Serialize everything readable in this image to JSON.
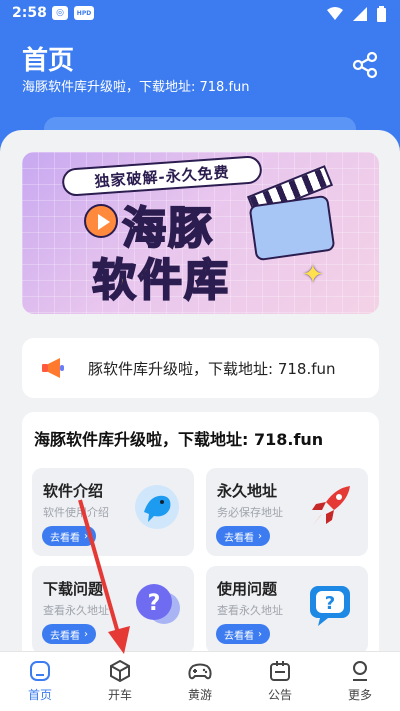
{
  "status_bar": {
    "time": "2:58",
    "badge": "HPD"
  },
  "header": {
    "title": "首页",
    "subtitle": "海豚软件库升级啦，下载地址: 718.fun"
  },
  "banner": {
    "tag": "独家破解-永久免费",
    "line1": "海豚",
    "line2": "软件库"
  },
  "notice": {
    "text": "豚软件库升级啦，下载地址: 718.fun"
  },
  "main": {
    "title": "海豚软件库升级啦，下载地址: 718.fun",
    "tiles": [
      {
        "title": "软件介绍",
        "desc": "软件使用介绍",
        "button": "去看看",
        "icon": "dolphin-icon"
      },
      {
        "title": "永久地址",
        "desc": "务必保存地址",
        "button": "去看看",
        "icon": "rocket-icon"
      },
      {
        "title": "下载问题",
        "desc": "查看永久地址",
        "button": "去看看",
        "icon": "question-bubble-icon"
      },
      {
        "title": "使用问题",
        "desc": "查看永久地址",
        "button": "去看看",
        "icon": "help-chat-icon"
      }
    ]
  },
  "bottom_nav": [
    {
      "label": "首页",
      "icon": "home-icon",
      "active": true
    },
    {
      "label": "开车",
      "icon": "cube-icon",
      "active": false
    },
    {
      "label": "黄游",
      "icon": "gamepad-icon",
      "active": false
    },
    {
      "label": "公告",
      "icon": "notice-icon",
      "active": false
    },
    {
      "label": "更多",
      "icon": "user-icon",
      "active": false
    }
  ],
  "colors": {
    "primary": "#3d7cf0",
    "background": "#f1f2f4",
    "accent_red": "#e53935"
  }
}
